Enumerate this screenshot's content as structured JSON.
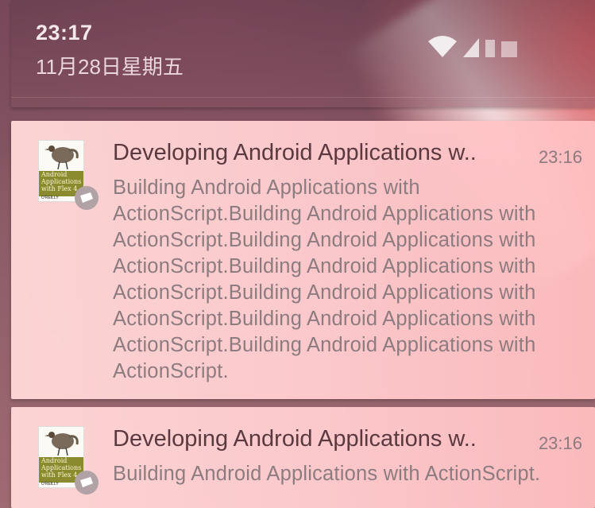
{
  "status": {
    "time": "23:17",
    "date": "11月28日星期五",
    "icons": [
      "wifi-icon",
      "signal-icon",
      "signal-empty-icon",
      "battery-icon"
    ]
  },
  "notifications": [
    {
      "title": "Developing Android Applications w..",
      "time": "23:16",
      "body_lines": [
        "Building Android Applications with",
        "ActionScript.Building Android Applications with",
        "ActionScript.Building Android Applications with",
        "ActionScript.Building Android Applications with",
        "ActionScript.Building Android Applications with",
        "ActionScript.Building Android Applications with",
        "ActionScript.Building Android Applications with",
        "ActionScript."
      ],
      "thumbnail": {
        "cover_text": "Android Applications with Flex 4",
        "publisher": "O'REILLY"
      },
      "app_icon": "ticket-icon"
    },
    {
      "title": "Developing Android Applications w..",
      "time": "23:16",
      "body_lines": [
        "Building Android Applications with ActionScript."
      ],
      "thumbnail": {
        "cover_text": "Android Applications with Flex 4",
        "publisher": "O'REILLY"
      },
      "app_icon": "ticket-icon"
    }
  ],
  "colors": {
    "card_bg": "#ffd4d6",
    "title_text": "#5a3a40",
    "body_text": "#8c7c80",
    "time_text": "#8c7a7e",
    "clock_text": "#f4e7ea"
  }
}
